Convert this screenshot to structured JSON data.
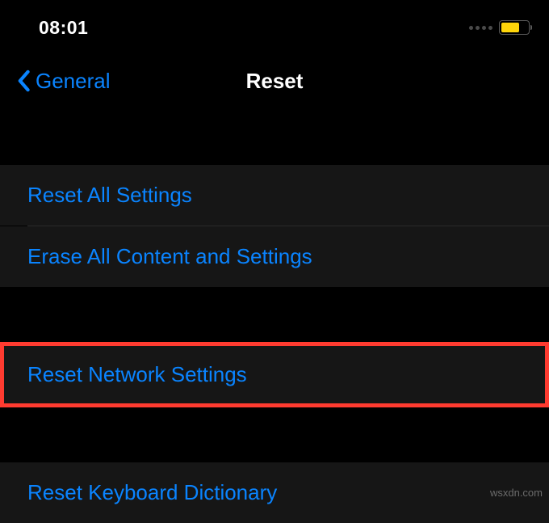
{
  "status": {
    "time": "08:01"
  },
  "nav": {
    "back_label": "General",
    "title": "Reset"
  },
  "cells": {
    "reset_all": "Reset All Settings",
    "erase_all": "Erase All Content and Settings",
    "reset_network": "Reset Network Settings",
    "reset_keyboard": "Reset Keyboard Dictionary"
  },
  "watermark": "wsxdn.com"
}
